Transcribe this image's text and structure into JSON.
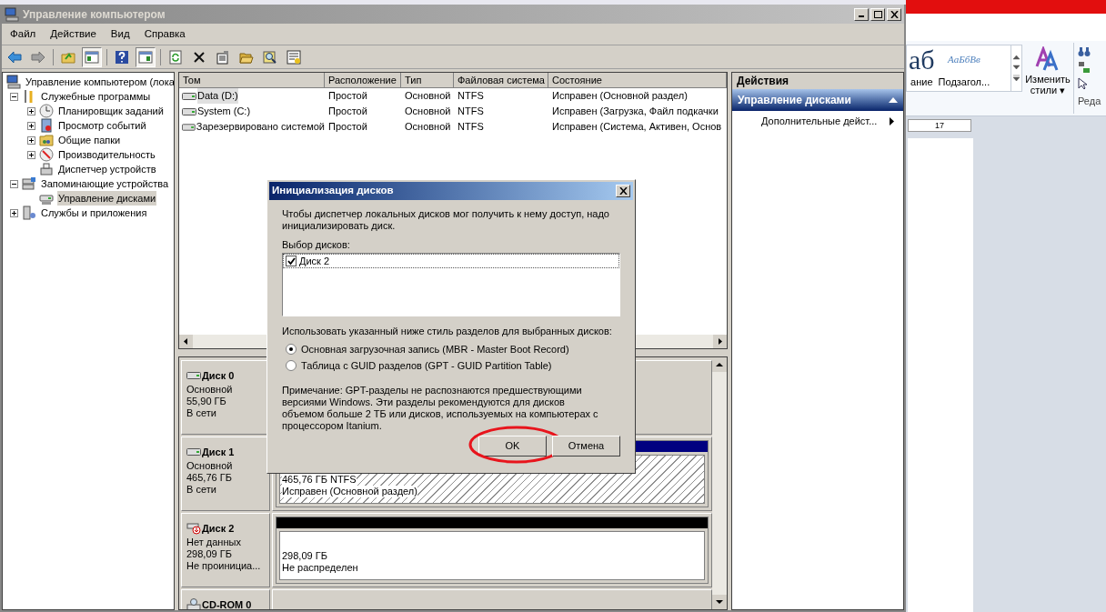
{
  "window": {
    "title": "Управление компьютером"
  },
  "menu": [
    "Файл",
    "Действие",
    "Вид",
    "Справка"
  ],
  "toolbar": [
    [
      {
        "kind": "back",
        "pressed": false
      },
      {
        "kind": "forward",
        "pressed": false
      }
    ],
    [
      {
        "kind": "up",
        "pressed": false
      },
      {
        "kind": "tree",
        "pressed": true
      }
    ],
    [
      {
        "kind": "help",
        "pressed": false
      },
      {
        "kind": "pane",
        "pressed": true
      }
    ],
    [
      {
        "kind": "refresh",
        "pressed": false
      },
      {
        "kind": "delete",
        "pressed": false
      },
      {
        "kind": "properties",
        "pressed": false
      },
      {
        "kind": "open",
        "pressed": false
      },
      {
        "kind": "search",
        "pressed": false
      },
      {
        "kind": "settings",
        "pressed": false
      }
    ]
  ],
  "tree": [
    {
      "label": "Управление компьютером (лока",
      "kind": "computer",
      "selected": false,
      "children": [
        {
          "label": "Служебные программы",
          "kind": "tools",
          "expanded": true,
          "selected": false,
          "children": [
            {
              "label": "Планировщик заданий",
              "kind": "clock",
              "expanded": false,
              "selected": false
            },
            {
              "label": "Просмотр событий",
              "kind": "log",
              "expanded": false,
              "selected": false
            },
            {
              "label": "Общие папки",
              "kind": "folder",
              "expanded": false,
              "selected": false
            },
            {
              "label": "Производительность",
              "kind": "gauge",
              "expanded": false,
              "selected": false
            },
            {
              "label": "Диспетчер устройств",
              "kind": "device",
              "selected": false
            }
          ]
        },
        {
          "label": "Запоминающие устройства",
          "kind": "storage",
          "expanded": true,
          "selected": false,
          "children": [
            {
              "label": "Управление дисками",
              "kind": "disk",
              "selected": true
            }
          ]
        },
        {
          "label": "Службы и приложения",
          "kind": "services",
          "expanded": false,
          "selected": false
        }
      ]
    }
  ],
  "volumes": {
    "columns": [
      "Том",
      "Расположение",
      "Тип",
      "Файловая система",
      "Состояние"
    ],
    "rows": [
      {
        "cells": [
          "Data (D:)",
          "Простой",
          "Основной",
          "NTFS",
          "Исправен (Основной раздел)"
        ],
        "selected": true
      },
      {
        "cells": [
          "System (C:)",
          "Простой",
          "Основной",
          "NTFS",
          "Исправен (Загрузка, Файл подкачки"
        ],
        "selected": false
      },
      {
        "cells": [
          "Зарезервировано системой",
          "Простой",
          "Основной",
          "NTFS",
          "Исправен (Система, Активен, Основ"
        ],
        "selected": false
      }
    ]
  },
  "disks": [
    {
      "name": "Диск 0",
      "kind": "disk",
      "lines": [
        "Основной",
        "55,90 ГБ",
        "В сети"
      ]
    },
    {
      "name": "Диск 1",
      "kind": "disk",
      "lines": [
        "Основной",
        "465,76 ГБ",
        "В сети"
      ],
      "partitions": [
        {
          "color": "#000080",
          "hatched": true,
          "lines": [
            "465,76 ГБ NTFS",
            "Исправен (Основной раздел)"
          ]
        }
      ]
    },
    {
      "name": "Диск 2",
      "kind": "uninitialized",
      "lines": [
        "Нет данных",
        "298,09 ГБ",
        "Не проинициа..."
      ],
      "partitions": [
        {
          "color": "#000000",
          "hatched": false,
          "lines": [
            "298,09 ГБ",
            "Не распределен"
          ]
        }
      ]
    },
    {
      "name": "CD-ROM 0",
      "kind": "cdrom"
    }
  ],
  "actions": {
    "title": "Действия",
    "section": "Управление дисками",
    "expanded": true,
    "items": [
      "Дополнительные дейст..."
    ]
  },
  "dialog": {
    "title": "Инициализация дисков",
    "intro": "Чтобы диспетчер локальных дисков мог получить к нему доступ, надо инициализировать диск.",
    "list_label": "Выбор дисков:",
    "disks": [
      {
        "label": "Диск 2",
        "checked": true
      }
    ],
    "style_label": "Использовать указанный ниже стиль разделов для выбранных дисков:",
    "options": [
      {
        "label": "Основная загрузочная запись (MBR - Master Boot Record)",
        "selected": true
      },
      {
        "label": "Таблица с GUID разделов (GPT - GUID Partition Table)",
        "selected": false
      }
    ],
    "note": "Примечание: GPT-разделы не распознаются предшествующими версиями Windows. Эти разделы рекомендуются для дисков объемом больше 2 ТБ или дисков, используемых на компьютерах с процессором Itanium.",
    "buttons": [
      {
        "label": "OK",
        "circled": true
      },
      {
        "label": "Отмена",
        "circled": false
      }
    ]
  },
  "word": {
    "styles": [
      {
        "sample": "аб",
        "label": "ание"
      },
      {
        "sample": "АаБбВв",
        "label": "Подзагол..."
      }
    ],
    "change_styles": [
      "Изменить",
      "стили ▾"
    ],
    "group_label": "Реда",
    "ruler": "17"
  }
}
